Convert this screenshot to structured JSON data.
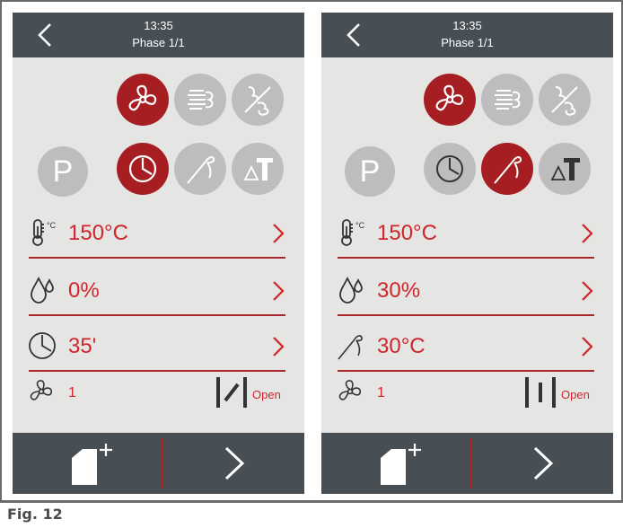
{
  "figure_caption": "Fig. 12",
  "screens": [
    {
      "time": "13:35",
      "phase": "Phase 1/1",
      "mode_row1": [
        "fan-icon",
        "steam-icon",
        "steam-off-icon"
      ],
      "mode_row2": [
        "P",
        "clock-icon",
        "probe-icon",
        "delta-t-icon"
      ],
      "active": [
        "fan",
        "clock"
      ],
      "rows": [
        {
          "icon": "thermometer-icon",
          "value": "150°C"
        },
        {
          "icon": "humidity-drops-icon",
          "value": "0%"
        },
        {
          "icon": "clock-icon",
          "value": "35'"
        }
      ],
      "fan_speed": "1",
      "vent_label": "Open",
      "colors": {
        "accent": "#a61e22",
        "text_red": "#d0252b",
        "bar": "#474f55",
        "bg": "#e5e5e3"
      }
    },
    {
      "time": "13:35",
      "phase": "Phase 1/1",
      "mode_row1": [
        "fan-icon",
        "steam-icon",
        "steam-off-icon"
      ],
      "mode_row2": [
        "P",
        "clock-icon",
        "probe-icon",
        "delta-t-icon"
      ],
      "active": [
        "fan",
        "probe"
      ],
      "rows": [
        {
          "icon": "thermometer-icon",
          "value": "150°C"
        },
        {
          "icon": "humidity-drops-icon",
          "value": "30%"
        },
        {
          "icon": "probe-icon",
          "value": "30°C"
        }
      ],
      "fan_speed": "1",
      "vent_label": "Open",
      "colors": {
        "accent": "#a61e22",
        "text_red": "#d0252b",
        "bar": "#474f55",
        "bg": "#e5e5e3"
      }
    }
  ],
  "p_label": "P",
  "delta_label": "ΔT"
}
